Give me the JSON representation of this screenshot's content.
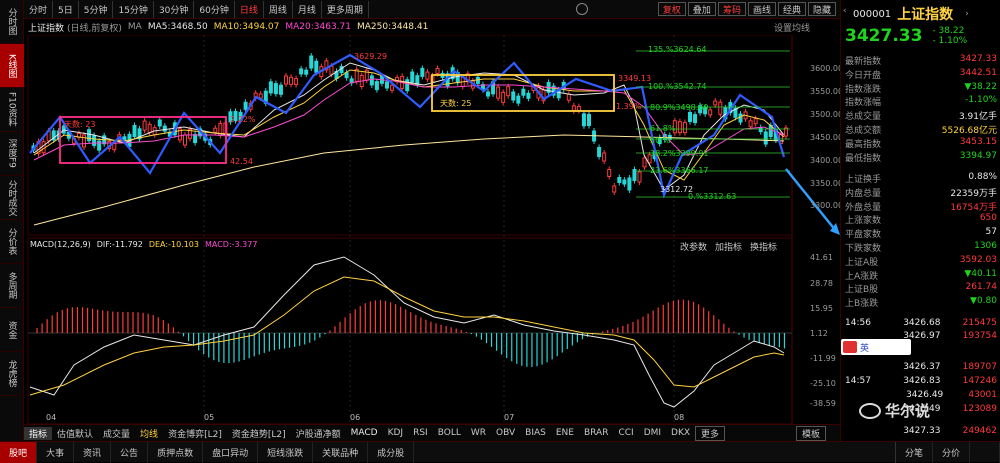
{
  "left_sidebar": [
    "分时图",
    "K线图",
    "F10资料",
    "深度F9",
    "分时成交",
    "分价表",
    "多周期",
    "资金",
    "龙虎榜"
  ],
  "period_tabs": [
    "分时",
    "5日",
    "5分钟",
    "15分钟",
    "30分钟",
    "60分钟",
    "日线",
    "周线",
    "月线",
    "更多周期"
  ],
  "toolbar_right": [
    "复权",
    "叠加",
    "筹码",
    "画线",
    "经典",
    "隐藏"
  ],
  "chart_title": "上证指数",
  "title_extra": "(日线,前复权)",
  "ma_label": "MA",
  "ma5": "MA5:3468.50",
  "ma10": "MA10:3494.07",
  "ma20": "MA20:3463.71",
  "ma250": "MA250:3448.41",
  "set_ma": "设置均线",
  "annotations": {
    "top_price": "3629.29",
    "fib_135": "135.%3624.64",
    "fib_100": "100.%3542.74",
    "fib_809": "80.9%3498.60",
    "fib_618": "61.8%",
    "fib_50": "50.%",
    "fib_382": "38.2%3399.91",
    "fib_236": "23.6%3366.17",
    "low_price": "3312.72",
    "fib_0": "0.%3312.63",
    "ann_3349": "3349.13",
    "ann_199": "1.39%",
    "ann_sub": "天数: 25",
    "ann_23": "天数: 23",
    "ann_2225": "2.22%",
    "ann_4254": "42.54"
  },
  "price_ticks": [
    "3600.00",
    "3550.00",
    "3500.00",
    "3450.00",
    "3400.00",
    "3350.00",
    "3300.00"
  ],
  "macd_title": "MACD(12,26,9)",
  "macd_dif": "DIF:-11.792",
  "macd_dea": "DEA:-10.103",
  "macd_val": "MACD:-3.377",
  "macd_buttons": [
    "改参数",
    "加指标",
    "换指标"
  ],
  "macd_ticks": [
    "41.61",
    "28.78",
    "15.95",
    "1.12",
    "-11.99",
    "-25.10",
    "-38.59"
  ],
  "dates": [
    "04",
    "05",
    "06",
    "07",
    "08"
  ],
  "indicator_tabs": [
    "指标",
    "估值默认",
    "成交量",
    "均线",
    "资金博弈[L2]",
    "资金趋势[L2]",
    "沪股通净额",
    "MACD",
    "KDJ",
    "RSI",
    "BOLL",
    "WR",
    "OBV",
    "BIAS",
    "ENE",
    "BRAR",
    "CCI",
    "DMI",
    "DKX",
    "更多",
    "模板"
  ],
  "bottom_tabs": [
    "股吧",
    "大事",
    "资讯",
    "公告",
    "质押点数",
    "盘口异动",
    "短线涨跌",
    "关联品种",
    "成分股"
  ],
  "stock_code": "000001",
  "stock_name": "上证指数",
  "price": "3427.33",
  "change": "- 38.22",
  "change_pct": "- 1.10%",
  "quote_rows": [
    {
      "l": "最新指数",
      "v": "3427.33",
      "c": "red"
    },
    {
      "l": "今日开盘",
      "v": "3442.51",
      "c": "red"
    },
    {
      "l": "指数涨跌",
      "v": "▼38.22",
      "c": "grn"
    },
    {
      "l": "指数涨幅",
      "v": "-1.10%",
      "c": "grn"
    },
    {
      "l": "总成交量",
      "v": "3.91亿手",
      "c": "wht"
    },
    {
      "l": "总成交额",
      "v": "5526.68亿元",
      "c": "yel"
    },
    {
      "l": "最高指数",
      "v": "3453.15",
      "c": "red"
    },
    {
      "l": "最低指数",
      "v": "3394.97",
      "c": "grn"
    }
  ],
  "stat_rows": [
    {
      "l": "上证换手",
      "v": "0.88%",
      "c": "wht"
    },
    {
      "l": "内盘总量",
      "v": "22359万手",
      "c": "wht"
    },
    {
      "l": "外盘总量",
      "v": "16754万手",
      "c": "red"
    },
    {
      "l": "上涨家数",
      "v": "650",
      "c": "red"
    },
    {
      "l": "平盘家数",
      "v": "57",
      "c": "wht"
    },
    {
      "l": "下跌家数",
      "v": "1306",
      "c": "grn"
    },
    {
      "l": "上证A股",
      "v": "3592.03",
      "c": "red"
    },
    {
      "l": "上A涨跌",
      "v": "▼40.11",
      "c": "grn"
    },
    {
      "l": "上证B股",
      "v": "261.74",
      "c": "red"
    },
    {
      "l": "上B涨跌",
      "v": "▼0.80",
      "c": "grn"
    }
  ],
  "ticks": [
    {
      "t": "14:56",
      "p": "3426.68",
      "v": "215475"
    },
    {
      "t": "",
      "p": "3426.97",
      "v": "193754"
    },
    {
      "t": "",
      "p": "3426.37",
      "v": "189707"
    },
    {
      "t": "14:57",
      "p": "3426.83",
      "v": "147246"
    },
    {
      "t": "",
      "p": "3426.49",
      "v": "43001"
    },
    {
      "t": "",
      "p": "3426.49",
      "v": "123089"
    },
    {
      "t": "",
      "p": "3427.33",
      "v": "249462"
    }
  ],
  "ime_label": "英",
  "watermark": "华尔说",
  "right_tabs": [
    "分笔",
    "分价"
  ]
}
